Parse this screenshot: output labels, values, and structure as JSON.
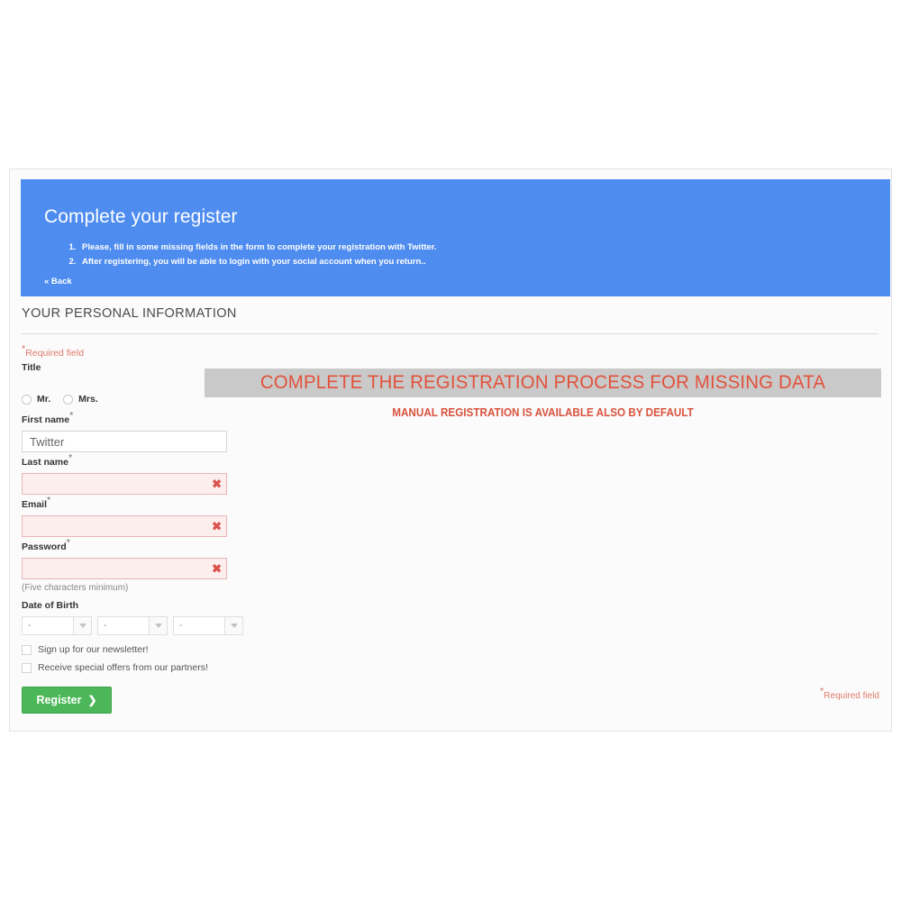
{
  "banner": {
    "title": "Complete your register",
    "steps": [
      "Please, fill in some missing fields in the form to complete your registration with Twitter.",
      "After registering, you will be able to login with your social account when you return.."
    ],
    "back_label": "« Back",
    "background_color": "#4e8cf0"
  },
  "form": {
    "section_heading": "YOUR PERSONAL INFORMATION",
    "required_note_top": "Required field",
    "required_note_bottom": "Required field",
    "required_note_color": "#e07a6a",
    "title_label": "Title",
    "title_options": [
      {
        "label": "Mr.",
        "selected": false
      },
      {
        "label": "Mrs.",
        "selected": false
      }
    ],
    "first_name_label": "First name",
    "first_name_value": "Twitter",
    "last_name_label": "Last name",
    "last_name_value": "",
    "email_label": "Email",
    "email_value": "",
    "password_label": "Password",
    "password_value": "",
    "password_hint": "(Five characters minimum)",
    "error_icon": "✖",
    "error_icon_color": "#d9534f",
    "dob_label": "Date of Birth",
    "dob_selects": [
      {
        "name": "day",
        "value": "-"
      },
      {
        "name": "month",
        "value": "-"
      },
      {
        "name": "year",
        "value": "-"
      }
    ],
    "newsletter_label": "Sign up for our newsletter!",
    "newsletter_checked": false,
    "offers_label": "Receive special offers from our partners!",
    "offers_checked": false,
    "register_label": "Register",
    "register_chevron": "❯",
    "register_color": "#4cb758"
  },
  "annotations": {
    "line1": "COMPLETE THE REGISTRATION PROCESS FOR MISSING DATA",
    "line2": "MANUAL REGISTRATION IS AVAILABLE ALSO BY DEFAULT",
    "text_color": "#e2523c",
    "highlight_color": "#c9c9c9"
  }
}
